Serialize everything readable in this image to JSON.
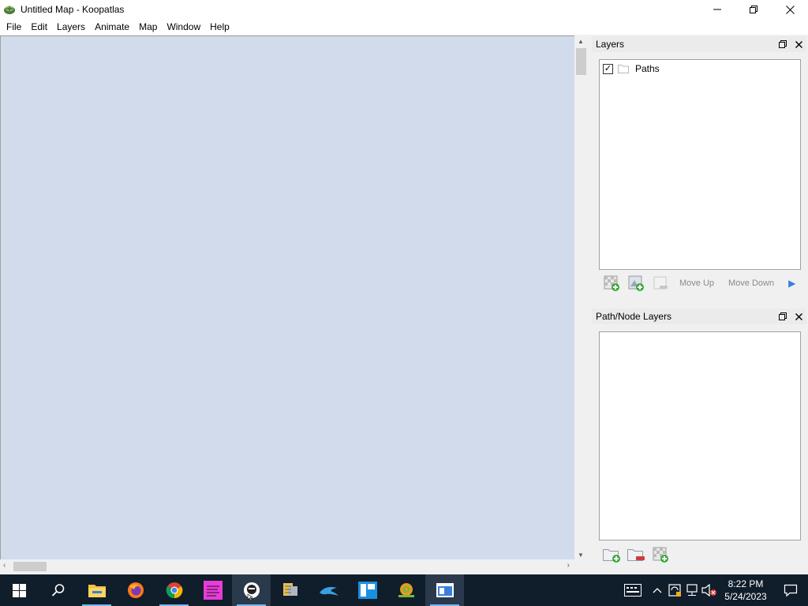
{
  "window": {
    "title": "Untitled Map - Koopatlas",
    "icon": "koopatlas-shell-icon"
  },
  "menu": {
    "items": [
      "File",
      "Edit",
      "Layers",
      "Animate",
      "Map",
      "Window",
      "Help"
    ]
  },
  "canvas": {
    "background": "#d2dbeb"
  },
  "layers_dock": {
    "title": "Layers",
    "items": [
      {
        "label": "Paths",
        "checked": true,
        "check_glyph": "✓"
      }
    ],
    "toolbar": {
      "move_up": "Move Up",
      "move_down": "Move Down"
    }
  },
  "path_node_dock": {
    "title": "Path/Node Layers"
  },
  "taskbar": {
    "apps": [
      "start-icon",
      "search-icon",
      "file-explorer-icon",
      "firefox-icon",
      "chrome-icon",
      "font-creek-icon",
      "cursor-app-icon",
      "tools-icon",
      "dolphin-icon",
      "window-app-icon",
      "snail-icon",
      "koopatlas-taskbar-icon"
    ],
    "clock_time": "8:22 PM",
    "clock_date": "5/24/2023"
  }
}
